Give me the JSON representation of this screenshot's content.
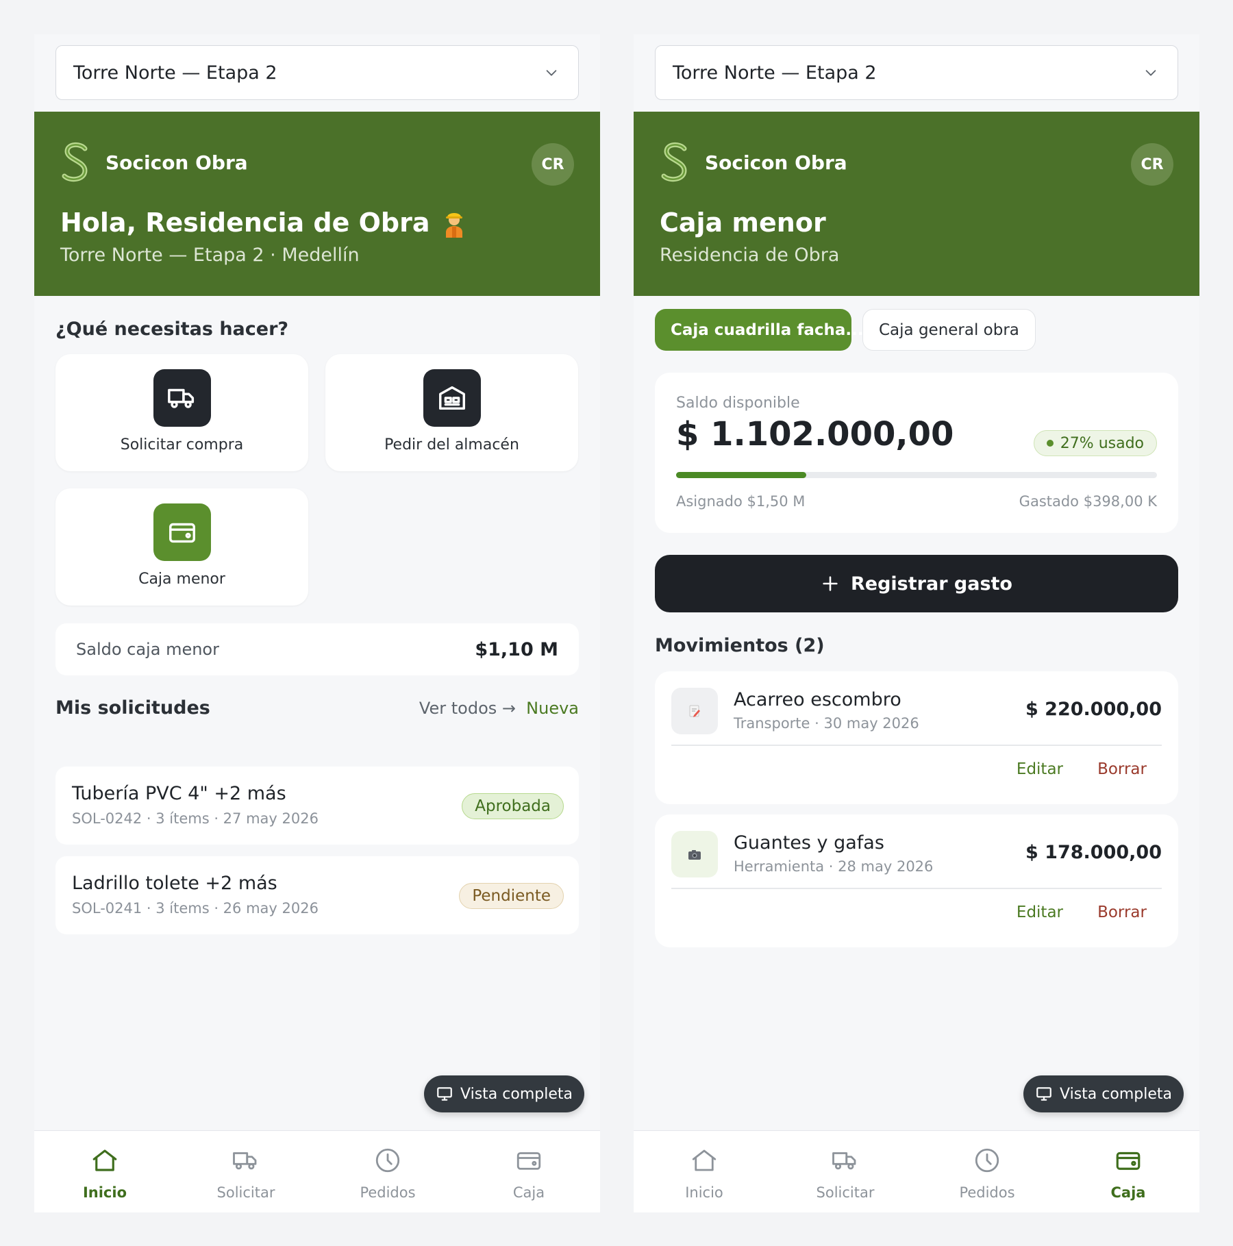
{
  "colors": {
    "brand_green": "#4b7129",
    "accent_green": "#5b8f2d",
    "dark": "#1e2126",
    "danger": "#9a3a2c"
  },
  "left": {
    "project_selector": "Torre Norte — Etapa 2",
    "brand_name": "Socicon Obra",
    "avatar_initials": "CR",
    "greeting": "Hola, Residencia de Obra",
    "location": "Torre Norte — Etapa 2 · Medellín",
    "actions_title": "¿Qué necesitas hacer?",
    "actions": [
      {
        "label": "Solicitar compra",
        "icon": "truck-icon"
      },
      {
        "label": "Pedir del almacén",
        "icon": "warehouse-icon"
      },
      {
        "label": "Caja menor",
        "icon": "wallet-icon"
      }
    ],
    "saldo_label": "Saldo caja menor",
    "saldo_value": "$1,10 M",
    "requests_title": "Mis solicitudes",
    "ver_todos": "Ver todos →",
    "nueva": "Nueva",
    "requests": [
      {
        "name": "Tubería PVC 4\" +2 más",
        "meta": "SOL-0242 · 3 ítems · 27 may 2026",
        "status": "Aprobada"
      },
      {
        "name": "Ladrillo tolete +2 más",
        "meta": "SOL-0241 · 3 ítems · 26 may 2026",
        "status": "Pendiente"
      }
    ],
    "vista_completa": "Vista completa"
  },
  "right": {
    "project_selector": "Torre Norte — Etapa 2",
    "brand_name": "Socicon Obra",
    "avatar_initials": "CR",
    "title": "Caja menor",
    "subtitle": "Residencia de Obra",
    "tabs": [
      {
        "label": "Caja cuadrilla facha...",
        "active": true
      },
      {
        "label": "Caja general obra",
        "active": false
      }
    ],
    "balance": {
      "label": "Saldo disponible",
      "amount": "$ 1.102.000,00",
      "usage": "27% usado",
      "usage_fraction": 0.27,
      "assigned": "Asignado $1,50 M",
      "spent": "Gastado $398,00 K"
    },
    "register_button": "Registrar gasto",
    "movements_title": "Movimientos (2)",
    "movements": [
      {
        "name": "Acarreo escombro",
        "meta": "Transporte · 30 may 2026",
        "amount": "$ 220.000,00",
        "edit": "Editar",
        "delete": "Borrar",
        "icon": "memo-icon"
      },
      {
        "name": "Guantes y gafas",
        "meta": "Herramienta · 28 may 2026",
        "amount": "$ 178.000,00",
        "edit": "Editar",
        "delete": "Borrar",
        "icon": "camera-icon"
      }
    ],
    "vista_completa": "Vista completa"
  },
  "nav": [
    "Inicio",
    "Solicitar",
    "Pedidos",
    "Caja"
  ]
}
